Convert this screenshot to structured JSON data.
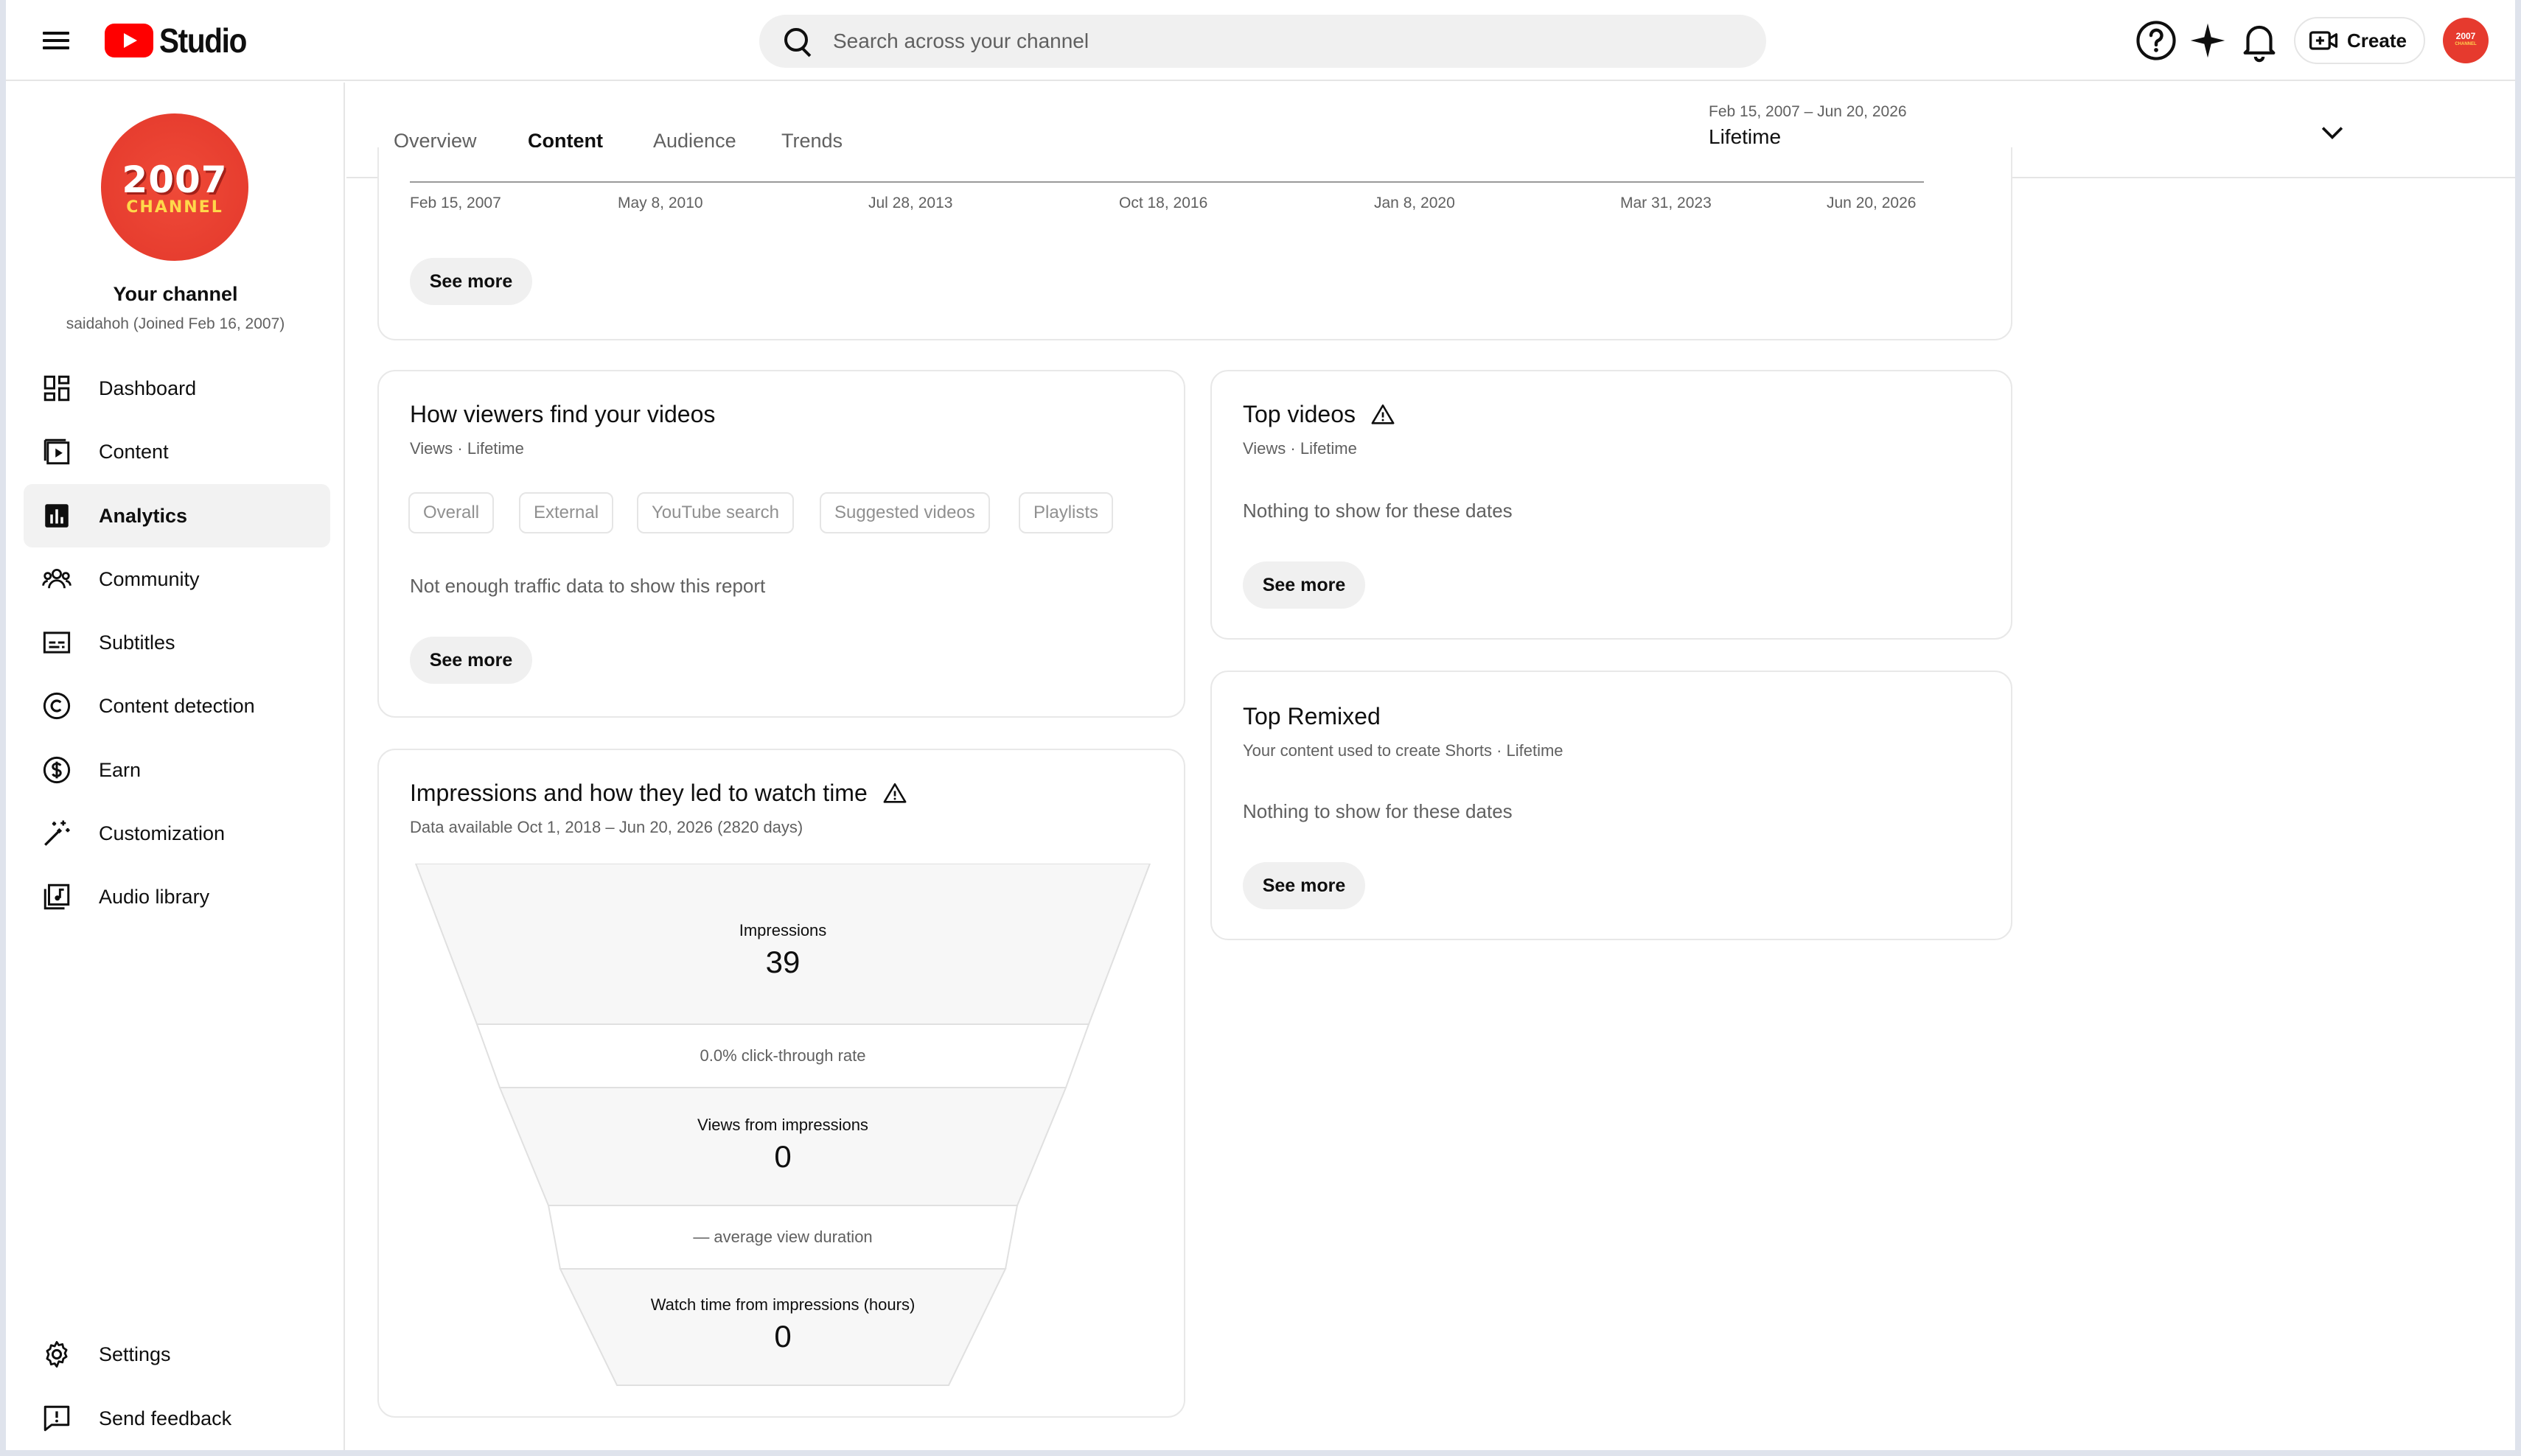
{
  "header": {
    "logo_text": "Studio",
    "search_placeholder": "Search across your channel",
    "create_label": "Create",
    "avatar_text": "2007",
    "avatar_sub": "CHANNEL"
  },
  "sidebar": {
    "channel_avatar_big": "2007",
    "channel_avatar_small": "CHANNEL",
    "channel_title": "Your channel",
    "channel_sub": "saidahoh (Joined Feb 16, 2007)",
    "items": [
      {
        "label": "Dashboard",
        "icon": "dashboard-icon"
      },
      {
        "label": "Content",
        "icon": "content-icon"
      },
      {
        "label": "Analytics",
        "icon": "analytics-icon"
      },
      {
        "label": "Community",
        "icon": "community-icon"
      },
      {
        "label": "Subtitles",
        "icon": "subtitles-icon"
      },
      {
        "label": "Content detection",
        "icon": "copyright-icon"
      },
      {
        "label": "Earn",
        "icon": "dollar-icon"
      },
      {
        "label": "Customization",
        "icon": "magic-wand-icon"
      },
      {
        "label": "Audio library",
        "icon": "audio-library-icon"
      }
    ],
    "bottom_items": [
      {
        "label": "Settings",
        "icon": "gear-icon"
      },
      {
        "label": "Send feedback",
        "icon": "feedback-icon"
      }
    ],
    "active_index": 2
  },
  "tabs": {
    "items": [
      "Overview",
      "Content",
      "Audience",
      "Trends"
    ],
    "active": "Content"
  },
  "date_filter": {
    "range": "Feb 15, 2007 – Jun 20, 2026",
    "label": "Lifetime"
  },
  "timeline": {
    "ticks": [
      "Feb 15, 2007",
      "May 8, 2010",
      "Jul 28, 2013",
      "Oct 18, 2016",
      "Jan 8, 2020",
      "Mar 31, 2023",
      "Jun 20, 2026"
    ],
    "see_more": "See more"
  },
  "traffic_card": {
    "title": "How viewers find your videos",
    "subtitle": "Views · Lifetime",
    "chips": [
      "Overall",
      "External",
      "YouTube search",
      "Suggested videos",
      "Playlists"
    ],
    "empty": "Not enough traffic data to show this report",
    "see_more": "See more"
  },
  "top_videos_card": {
    "title": "Top videos",
    "subtitle": "Views · Lifetime",
    "empty": "Nothing to show for these dates",
    "see_more": "See more"
  },
  "top_remixed_card": {
    "title": "Top Remixed",
    "subtitle": "Your content used to create Shorts · Lifetime",
    "empty": "Nothing to show for these dates",
    "see_more": "See more"
  },
  "impressions_card": {
    "title": "Impressions and how they led to watch time",
    "subtitle": "Data available Oct 1, 2018 – Jun 20, 2026 (2820 days)",
    "impressions_label": "Impressions",
    "impressions_value": "39",
    "ctr_text": "0.0% click-through rate",
    "views_label": "Views from impressions",
    "views_value": "0",
    "avg_duration_text": "— average view duration",
    "watch_label": "Watch time from impressions (hours)",
    "watch_value": "0"
  }
}
